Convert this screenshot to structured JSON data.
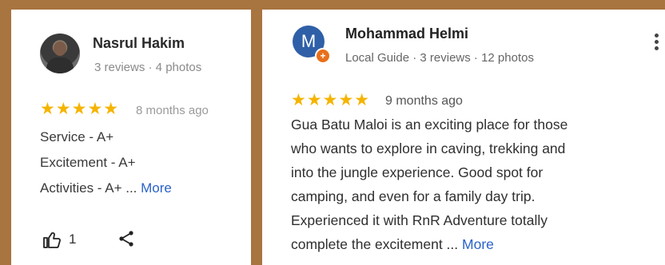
{
  "left_review": {
    "reviewer_name": "Nasrul Hakim",
    "reviewer_meta": "3 reviews · 4 photos",
    "stars": "★★★★★",
    "time": "8 months ago",
    "lines": [
      "Service - A+",
      "Excitement - A+",
      "Activities - A+ ..."
    ],
    "more_label": "More",
    "likes": "1"
  },
  "right_review": {
    "avatar_letter": "M",
    "reviewer_name": "Mohammad Helmi",
    "reviewer_meta": "Local Guide · 3 reviews · 12 photos",
    "stars": "★★★★★",
    "time": "9 months ago",
    "lines": [
      "Gua Batu Maloi is an exciting place for those",
      "who wants to explore in caving, trekking and",
      "into the jungle experience. Good spot for",
      "camping, and even for a family day trip.",
      "Experienced it with RnR Adventure totally",
      "complete the excitement ..."
    ],
    "more_label": "More"
  },
  "colors": {
    "star": "#f5b400",
    "link": "#2a62c9",
    "avatar_bg": "#2f5fa7",
    "badge": "#e8701a",
    "frame": "#a8743f"
  },
  "icons": {
    "thumbs_up": "thumbs-up-icon",
    "share": "share-icon",
    "more_options": "more-vertical-icon",
    "local_guide_badge": "local-guide-badge-icon"
  }
}
